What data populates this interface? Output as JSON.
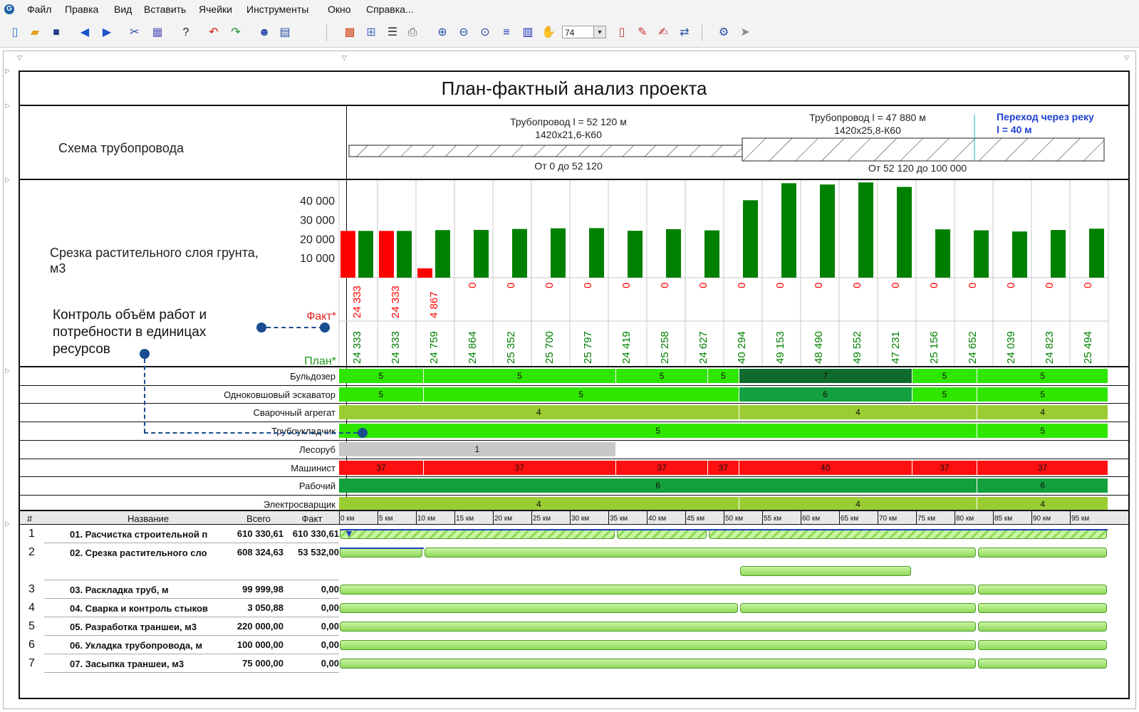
{
  "menu": [
    "Файл",
    "Правка",
    "Вид",
    "Вставить",
    "Ячейки",
    "Инструменты",
    "Окно",
    "Справка..."
  ],
  "toolbar": {
    "zoom_value": "74",
    "icons": [
      "new-file-icon",
      "open-folder-icon",
      "save-icon",
      "back-icon",
      "forward-icon",
      "tools-icon",
      "grid-icon",
      "help-icon",
      "undo-icon",
      "redo-icon",
      "user-icon",
      "table-icon",
      "chart-icon",
      "columns-icon",
      "filter-icon",
      "print-preview-icon",
      "zoom-in-icon",
      "zoom-out-icon",
      "zoom-fit-icon",
      "rows-icon",
      "columns-bars-icon",
      "hand-icon",
      "page-icon",
      "edit-chart-icon",
      "edit-icon",
      "export-icon",
      "settings-icon",
      "arrow-icon"
    ]
  },
  "report": {
    "title": "План-фактный анализ проекта",
    "pipeline": {
      "label": "Схема трубопровода",
      "segment1_title": "Трубопровод l = 52 120 м",
      "segment1_spec": "1420x21,6-К60",
      "segment1_range": "От 0 до 52 120",
      "segment2_title": "Трубопровод l = 47 880 м",
      "segment2_spec": "1420x25,8-К60",
      "segment2_range": "От 52 120 до 100 000",
      "river_title": "Переход через реку",
      "river_length": "l = 40 м"
    },
    "stripping": {
      "label": "Срезка растительного слоя грунта, м3",
      "fact_label": "Факт*",
      "plan_label": "План*",
      "y_ticks": [
        "40 000",
        "30 000",
        "20 000",
        "10 000"
      ]
    },
    "annotation": {
      "text": "Контроль объём работ и потребности в единицах ресурсов"
    },
    "resources": [
      {
        "name": "Бульдозер",
        "segments": [
          {
            "from": 0,
            "to": 22,
            "value": "5",
            "color": "#2ee600"
          },
          {
            "from": 22,
            "to": 72,
            "value": "5",
            "color": "#2ee600"
          },
          {
            "from": 72,
            "to": 96,
            "value": "5",
            "color": "#2ee600"
          },
          {
            "from": 96,
            "to": 104,
            "value": "5",
            "color": "#2ee600"
          },
          {
            "from": 104,
            "to": 149,
            "value": "7",
            "color": "#0f6b2c"
          },
          {
            "from": 149,
            "to": 166,
            "value": "5",
            "color": "#2ee600"
          },
          {
            "from": 166,
            "to": 200,
            "value": "5",
            "color": "#2ee600"
          }
        ]
      },
      {
        "name": "Одноковшовый эскаватор",
        "segments": [
          {
            "from": 0,
            "to": 22,
            "value": "5",
            "color": "#2ee600"
          },
          {
            "from": 22,
            "to": 104,
            "value": "5",
            "color": "#2ee600"
          },
          {
            "from": 104,
            "to": 149,
            "value": "6",
            "color": "#12a040"
          },
          {
            "from": 149,
            "to": 166,
            "value": "5",
            "color": "#2ee600"
          },
          {
            "from": 166,
            "to": 200,
            "value": "5",
            "color": "#2ee600"
          }
        ]
      },
      {
        "name": "Сварочный агрегат",
        "segments": [
          {
            "from": 0,
            "to": 104,
            "value": "4",
            "color": "#9acd32"
          },
          {
            "from": 104,
            "to": 166,
            "value": "4",
            "color": "#9acd32"
          },
          {
            "from": 166,
            "to": 200,
            "value": "4",
            "color": "#9acd32"
          }
        ]
      },
      {
        "name": "Трубоукладчик",
        "segments": [
          {
            "from": 0,
            "to": 166,
            "value": "5",
            "color": "#2ee600"
          },
          {
            "from": 166,
            "to": 200,
            "value": "5",
            "color": "#2ee600"
          }
        ]
      },
      {
        "name": "Лесоруб",
        "segments": [
          {
            "from": 0,
            "to": 72,
            "value": "1",
            "color": "#c8c8c8"
          }
        ]
      },
      {
        "name": "Машинист",
        "segments": [
          {
            "from": 0,
            "to": 22,
            "value": "37",
            "color": "#ff1010"
          },
          {
            "from": 22,
            "to": 72,
            "value": "37",
            "color": "#ff1010"
          },
          {
            "from": 72,
            "to": 96,
            "value": "37",
            "color": "#ff1010"
          },
          {
            "from": 96,
            "to": 104,
            "value": "37",
            "color": "#ff1010"
          },
          {
            "from": 104,
            "to": 149,
            "value": "40",
            "color": "#ff1010"
          },
          {
            "from": 149,
            "to": 166,
            "value": "37",
            "color": "#ff1010"
          },
          {
            "from": 166,
            "to": 200,
            "value": "37",
            "color": "#ff1010"
          }
        ]
      },
      {
        "name": "Рабочий",
        "segments": [
          {
            "from": 0,
            "to": 166,
            "value": "6",
            "color": "#13a03c"
          },
          {
            "from": 166,
            "to": 200,
            "value": "6",
            "color": "#13a03c"
          }
        ]
      },
      {
        "name": "Электросварщик",
        "segments": [
          {
            "from": 0,
            "to": 104,
            "value": "4",
            "color": "#9acd32"
          },
          {
            "from": 104,
            "to": 166,
            "value": "4",
            "color": "#9acd32"
          },
          {
            "from": 166,
            "to": 200,
            "value": "4",
            "color": "#9acd32"
          }
        ]
      }
    ],
    "gantt": {
      "headers": {
        "num": "#",
        "name": "Название",
        "total": "Всего",
        "fact": "Факт"
      },
      "km_labels": [
        "0 км",
        "5 км",
        "10 км",
        "15 км",
        "20 км",
        "25 км",
        "30 км",
        "35 км",
        "40 км",
        "45 км",
        "50 км",
        "55 км",
        "60 км",
        "65 км",
        "70 км",
        "75 км",
        "80 км",
        "85 км",
        "90 км",
        "95 км"
      ],
      "rows": [
        {
          "num": "1",
          "name": "01. Расчистка строительной п",
          "total": "610 330,61",
          "fact": "610 330,61",
          "bars": [
            {
              "from": 0,
              "to": 72,
              "hatch": true
            },
            {
              "from": 72,
              "to": 96,
              "hatch": true
            },
            {
              "from": 96,
              "to": 200,
              "hatch": true
            }
          ]
        },
        {
          "num": "2",
          "name": "02. Срезка растительного сло",
          "total": "608 324,63",
          "fact": "53 532,00",
          "bars": [
            {
              "from": 0,
              "to": 22
            },
            {
              "from": 22,
              "to": 166
            },
            {
              "from": 166,
              "to": 200
            },
            {
              "from": 104,
              "to": 149,
              "sub": true
            }
          ]
        },
        {
          "num": "3",
          "name": "03. Раскладка труб, м",
          "total": "99 999,98",
          "fact": "0,00",
          "bars": [
            {
              "from": 0,
              "to": 166
            },
            {
              "from": 166,
              "to": 200
            }
          ]
        },
        {
          "num": "4",
          "name": "04. Сварка и контроль стыков",
          "total": "3 050,88",
          "fact": "0,00",
          "bars": [
            {
              "from": 0,
              "to": 104
            },
            {
              "from": 104,
              "to": 166
            },
            {
              "from": 166,
              "to": 200
            }
          ]
        },
        {
          "num": "5",
          "name": "05. Разработка траншеи, м3",
          "total": "220 000,00",
          "fact": "0,00",
          "bars": [
            {
              "from": 0,
              "to": 166
            },
            {
              "from": 166,
              "to": 200
            }
          ]
        },
        {
          "num": "6",
          "name": "06. Укладка трубопровода, м",
          "total": "100 000,00",
          "fact": "0,00",
          "bars": [
            {
              "from": 0,
              "to": 166
            },
            {
              "from": 166,
              "to": 200
            }
          ]
        },
        {
          "num": "7",
          "name": "07. Засыпка траншеи, м3",
          "total": "75 000,00",
          "fact": "0,00",
          "bars": [
            {
              "from": 0,
              "to": 166
            },
            {
              "from": 166,
              "to": 200
            }
          ]
        }
      ]
    }
  },
  "chart_data": {
    "type": "bar",
    "title": "",
    "ylabel": "Срезка растительного слоя грунта, м3",
    "ylim": [
      0,
      50000
    ],
    "y_ticks": [
      10000,
      20000,
      30000,
      40000
    ],
    "categories": [
      "0 км",
      "5 км",
      "10 км",
      "15 км",
      "20 км",
      "25 км",
      "30 км",
      "35 км",
      "40 км",
      "45 км",
      "50 км",
      "55 км",
      "60 км",
      "65 км",
      "70 км",
      "75 км",
      "80 км",
      "85 км",
      "90 км",
      "95 км"
    ],
    "series": [
      {
        "name": "Факт*",
        "color": "#ff0000",
        "values": [
          24333,
          24333,
          4867,
          0,
          0,
          0,
          0,
          0,
          0,
          0,
          0,
          0,
          0,
          0,
          0,
          0,
          0,
          0,
          0,
          0
        ],
        "labels": [
          "24 333",
          "24 333",
          "4 867",
          "0",
          "0",
          "0",
          "0",
          "0",
          "0",
          "0",
          "0",
          "0",
          "0",
          "0",
          "0",
          "0",
          "0",
          "0",
          "0",
          "0"
        ]
      },
      {
        "name": "План*",
        "color": "#008000",
        "values": [
          24333,
          24333,
          24759,
          24864,
          25352,
          25700,
          25797,
          24419,
          25258,
          24627,
          40294,
          49153,
          48490,
          49552,
          47231,
          25156,
          24652,
          24039,
          24823,
          25494
        ],
        "labels": [
          "24 333",
          "24 333",
          "24 759",
          "24 864",
          "25 352",
          "25 700",
          "25 797",
          "24 419",
          "25 258",
          "24 627",
          "40 294",
          "49 153",
          "48 490",
          "49 552",
          "47 231",
          "25 156",
          "24 652",
          "24 039",
          "24 823",
          "25 494"
        ]
      }
    ],
    "grid": true
  }
}
